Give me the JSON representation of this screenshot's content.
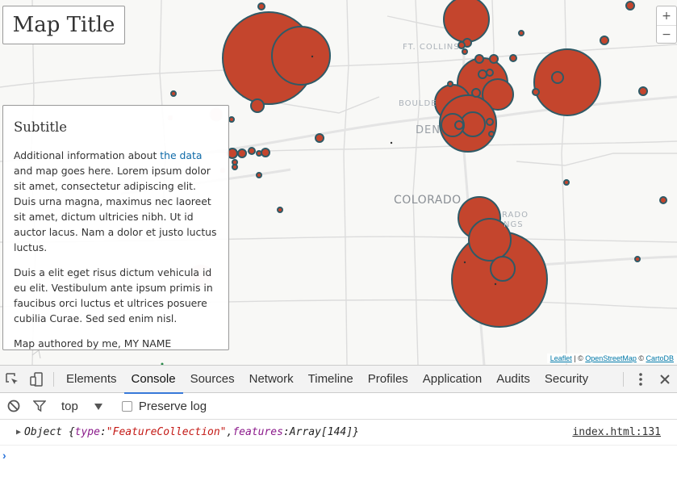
{
  "map": {
    "title": "Map Title",
    "subtitle": "Subtitle",
    "info_text_before_link": "Additional information about ",
    "info_link": "the data",
    "info_text_after_link": " and map goes here. Lorem ipsum dolor sit amet, consectetur adipiscing elit. Duis urna magna, maximus nec laoreet sit amet, dictum ultricies nibh. Ut id auctor lacus. Nam a dolor et justo luctus luctus.",
    "info_paragraph_2": "Duis a elit eget risus dictum vehicula id eu elit. Vestibulum ante ipsum primis in faucibus orci luctus et ultrices posuere cubilia Curae. Sed sed enim nisl.",
    "author_line": "Map authored by me, MY NAME",
    "zoom_in": "+",
    "zoom_out": "−",
    "labels": {
      "ft_collins": "FT. COLLINS",
      "boulder": "BOULDE",
      "denver": "DEN",
      "colorado": "COLORADO",
      "springs_1": "RADO",
      "springs_2": "NGS"
    },
    "attribution": {
      "leaflet": "Leaflet",
      "sep1": " | © ",
      "osm": "OpenStreetMap",
      "sep2": " © ",
      "carto": "CartoDB"
    },
    "colors": {
      "bubble_fill": "#c4452d",
      "bubble_stroke": "#2f5a66"
    }
  },
  "devtools": {
    "tabs": [
      "Elements",
      "Console",
      "Sources",
      "Network",
      "Timeline",
      "Profiles",
      "Application",
      "Audits",
      "Security"
    ],
    "active_tab": "Console",
    "context": "top",
    "preserve_log": "Preserve log",
    "log": {
      "prefix": "Object {",
      "key1": "type",
      "colon1": ": ",
      "val1": "\"FeatureCollection\"",
      "comma": ", ",
      "key2": "features",
      "colon2": ": ",
      "val2": "Array[144]",
      "suffix": "}",
      "source": "index.html:131"
    },
    "prompt": "›",
    "icons": [
      "inspect-icon",
      "device-icon",
      "more-icon",
      "close-icon",
      "clear-icon",
      "filter-icon",
      "dropdown-icon"
    ]
  }
}
